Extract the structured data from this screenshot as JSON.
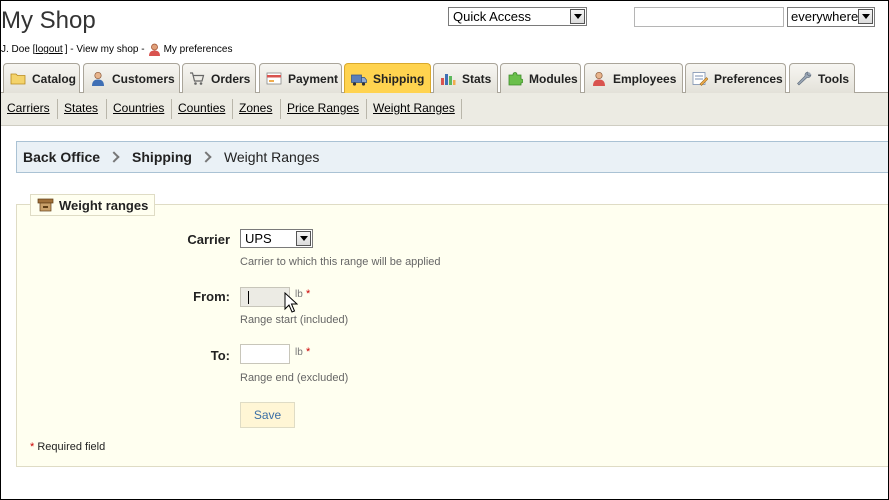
{
  "header": {
    "shop_name": "My Shop",
    "user_name": "J. Doe [",
    "logout_label": "logout",
    "view_shop_text": "] - View my shop -",
    "preferences_label": "My preferences",
    "quick_access": {
      "value": "Quick Access"
    },
    "search": {
      "value": "",
      "placeholder": ""
    },
    "search_scope": {
      "value": "everywhere"
    }
  },
  "tabs": [
    {
      "label": "Catalog",
      "icon": "folder-icon"
    },
    {
      "label": "Customers",
      "icon": "user-icon"
    },
    {
      "label": "Orders",
      "icon": "cart-icon"
    },
    {
      "label": "Payment",
      "icon": "payment-icon"
    },
    {
      "label": "Shipping",
      "icon": "truck-icon",
      "active": true
    },
    {
      "label": "Stats",
      "icon": "chart-icon"
    },
    {
      "label": "Modules",
      "icon": "puzzle-icon"
    },
    {
      "label": "Employees",
      "icon": "employee-icon"
    },
    {
      "label": "Preferences",
      "icon": "preferences-icon"
    },
    {
      "label": "Tools",
      "icon": "wrench-icon"
    }
  ],
  "subtabs": [
    "Carriers",
    "States",
    "Countries",
    "Counties",
    "Zones",
    "Price Ranges",
    "Weight Ranges"
  ],
  "breadcrumb": {
    "root": "Back Office",
    "section": "Shipping",
    "current": "Weight Ranges"
  },
  "form": {
    "legend": "Weight ranges",
    "carrier": {
      "label": "Carrier",
      "value": "UPS",
      "help": "Carrier to which this range will be applied"
    },
    "from": {
      "label": "From:",
      "value": "",
      "unit": "lb",
      "required_mark": "*",
      "help": "Range start (included)"
    },
    "to": {
      "label": "To:",
      "value": "",
      "unit": "lb",
      "required_mark": "*",
      "help": "Range end (excluded)"
    },
    "save_label": "Save",
    "required_star": "*",
    "required_note": " Required field"
  },
  "colors": {
    "active_tab": "#ffd34f",
    "breadcrumb_bg": "#eaf1f6",
    "fieldset_bg": "#fffff0",
    "link_blue": "#3a6ea5",
    "required_red": "#cc0000"
  }
}
